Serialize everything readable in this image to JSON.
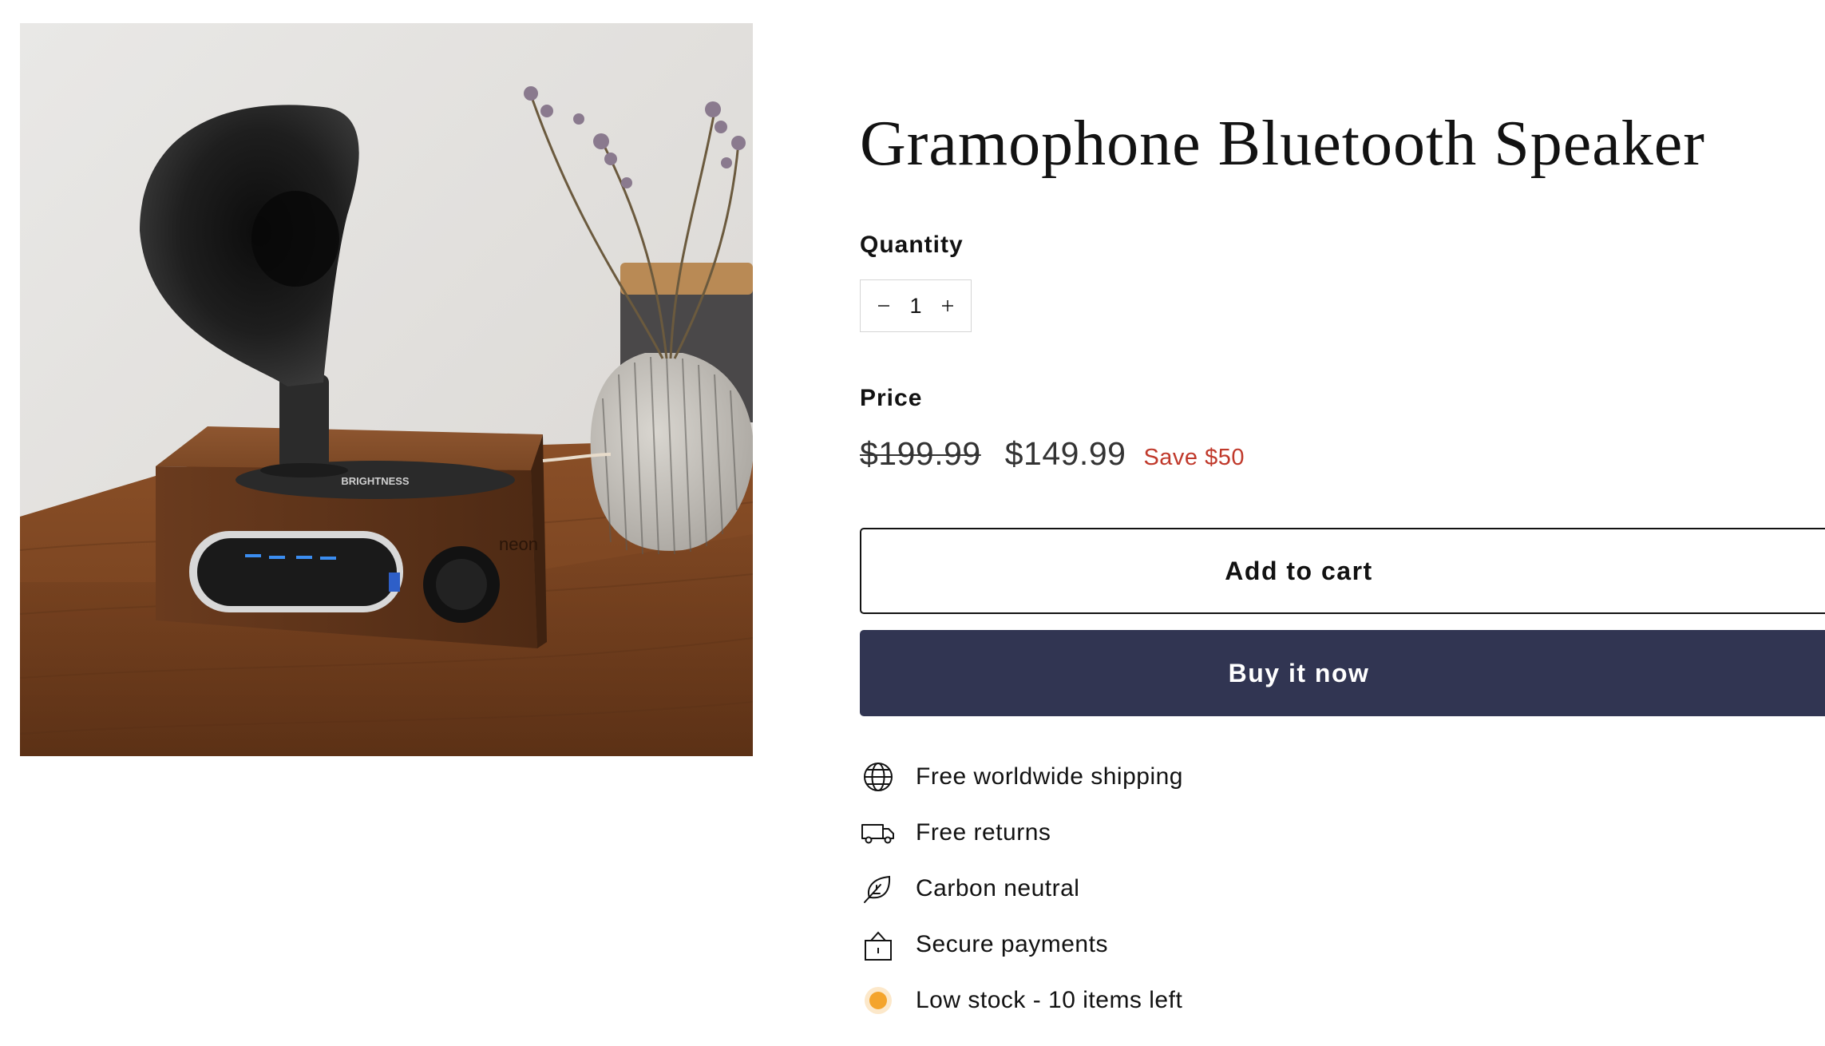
{
  "product": {
    "title": "Gramophone Bluetooth Speaker",
    "image_alt": "Gramophone Bluetooth Speaker",
    "image_brand_mark": "neon",
    "image_panel_text": "BRIGHTNESS"
  },
  "quantity": {
    "label": "Quantity",
    "value": "1",
    "decrease_icon": "minus-icon",
    "increase_icon": "plus-icon"
  },
  "price": {
    "label": "Price",
    "compare_at": "$199.99",
    "current": "$149.99",
    "save": "Save $50",
    "save_color": "#c0392b"
  },
  "buttons": {
    "add_to_cart": "Add to cart",
    "buy_now": "Buy it now",
    "buy_now_color": "#313552"
  },
  "features": [
    {
      "icon": "globe-icon",
      "text": "Free worldwide shipping"
    },
    {
      "icon": "truck-icon",
      "text": "Free returns"
    },
    {
      "icon": "leaf-icon",
      "text": "Carbon neutral"
    },
    {
      "icon": "lock-icon",
      "text": "Secure payments"
    },
    {
      "icon": "stock-dot-icon",
      "text": "Low stock - 10 items left"
    }
  ],
  "stock_dot_color": "#f4a42c"
}
